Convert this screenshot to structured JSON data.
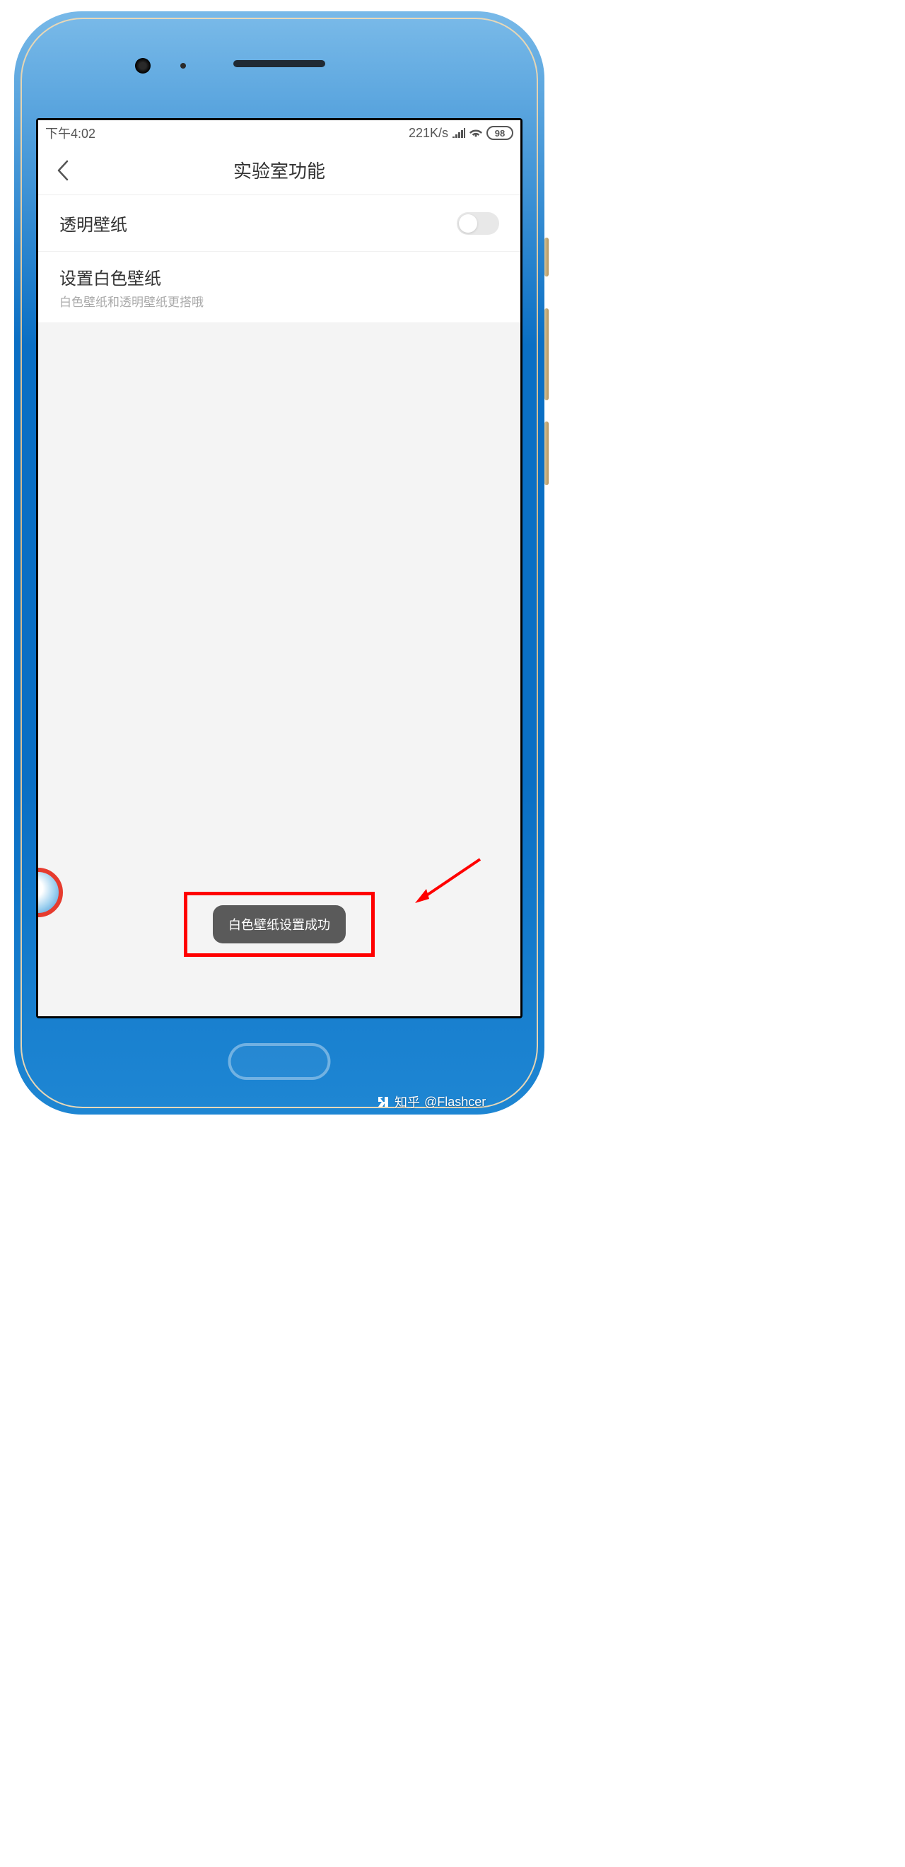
{
  "status_bar": {
    "time": "下午4:02",
    "network_speed": "221K/s",
    "battery": "98"
  },
  "header": {
    "title": "实验室功能"
  },
  "settings": {
    "transparent_wallpaper": {
      "label": "透明壁纸"
    },
    "white_wallpaper": {
      "label": "设置白色壁纸",
      "hint": "白色壁纸和透明壁纸更搭哦"
    }
  },
  "toast": {
    "message": "白色壁纸设置成功"
  },
  "watermark": {
    "site": "知乎",
    "handle": "@Flashcer"
  }
}
